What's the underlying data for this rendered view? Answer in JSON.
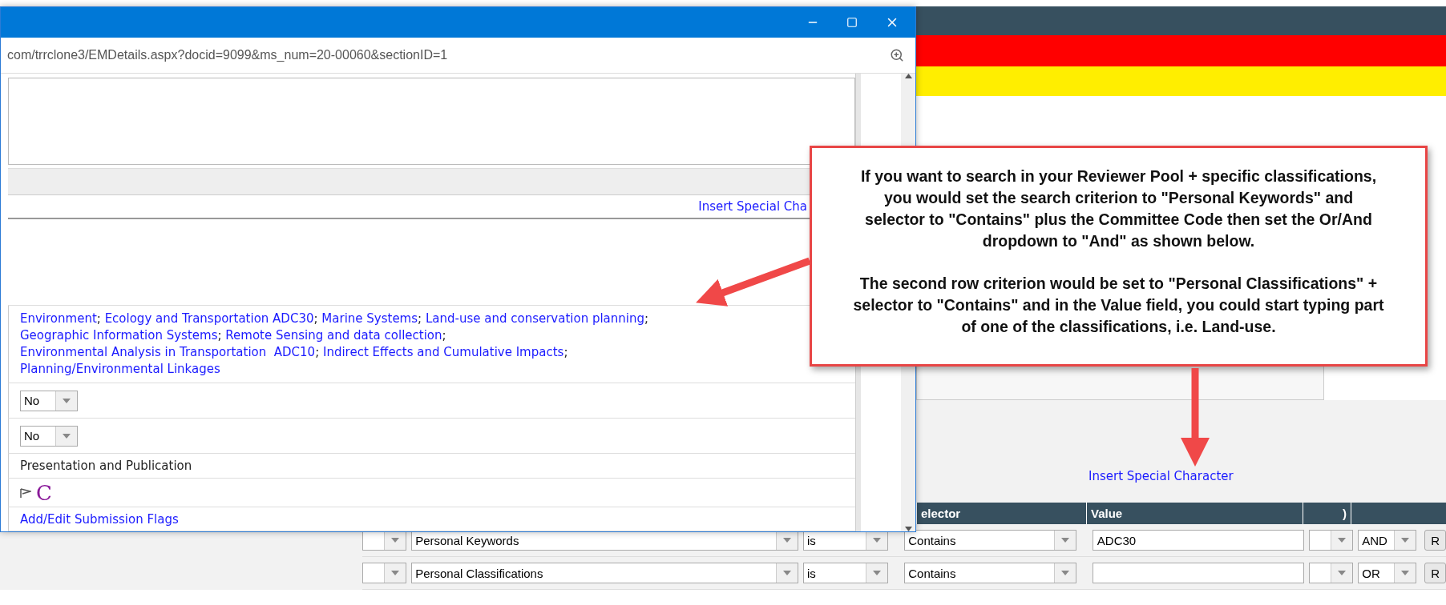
{
  "popup_window": {
    "address": "com/trrclone3/EMDetails.aspx?docid=9099&ms_num=20-00060&sectionID=1",
    "insert_link": "Insert Special Cha",
    "classification_lines": [
      {
        "items": [
          {
            "text": "Environment",
            "sep": ";"
          },
          {
            "text": "Ecology and Transportation ADC30",
            "sep": ";"
          },
          {
            "text": "Marine Systems",
            "sep": ";"
          },
          {
            "text": "Land-use and conservation planning",
            "sep": ";"
          }
        ]
      },
      {
        "items": [
          {
            "text": "Geographic Information Systems",
            "sep": ";"
          },
          {
            "text": "Remote Sensing and data collection",
            "sep": ";"
          }
        ]
      },
      {
        "items": [
          {
            "text": "Environmental Analysis in Transportation  ADC10",
            "sep": ";"
          },
          {
            "text": "Indirect Effects and Cumulative Impacts",
            "sep": ";"
          }
        ]
      },
      {
        "items": [
          {
            "text": "Planning/Environmental Linkages"
          }
        ]
      }
    ],
    "dropdowns": [
      "No",
      "No"
    ],
    "section": "Presentation and Publication",
    "flag_letter": "C",
    "flags_link": "Add/Edit Submission Flags"
  },
  "callout": {
    "paragraphs": [
      "If you want to search in your Reviewer Pool + specific classifications, you would set the search criterion to \"Personal Keywords\" and selector to \"Contains\" plus the Committee Code then set the Or/And dropdown to \"And\" as shown below.",
      "The second row criterion would be set to \"Personal Classifications\" + selector to \"Contains\" and in the Value field, you could start typing part of one of the classifications, i.e. Land-use."
    ]
  },
  "page": {
    "insert_link": "Insert Special Character",
    "columns": [
      "elector",
      "Value",
      ")"
    ],
    "rows": [
      {
        "criterion": "Personal Keywords",
        "operator": "is",
        "selector": "Contains",
        "value": "ADC30",
        "logic": "AND",
        "button": "R"
      },
      {
        "criterion": "Personal Classifications",
        "operator": "is",
        "selector": "Contains",
        "logic": "OR",
        "button": "R"
      }
    ]
  }
}
